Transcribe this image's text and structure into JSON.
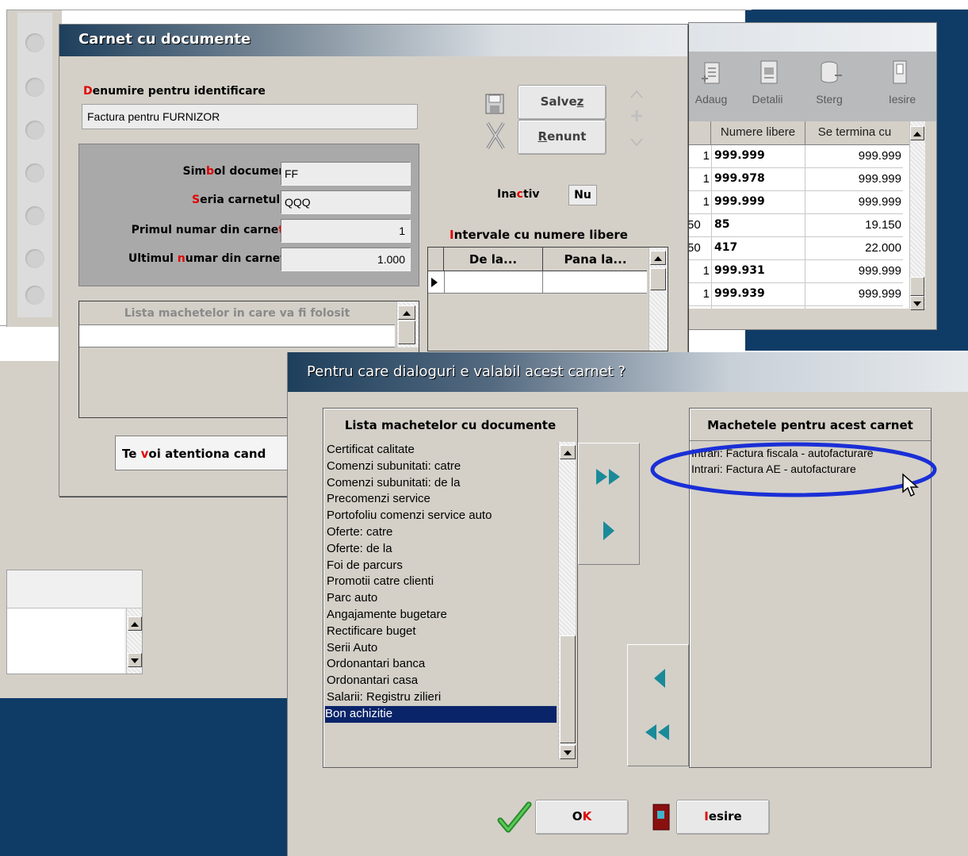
{
  "carnet_window": {
    "title": "Carnet cu documente",
    "denumire_label_first": "D",
    "denumire_label_rest": "enumire pentru identificare",
    "denumire_value": "Factura pentru FURNIZOR",
    "simbol_label_a": "Sim",
    "simbol_label_b": "b",
    "simbol_label_c": "ol document",
    "simbol_value": "FF",
    "seria_label_a": "S",
    "seria_label_b": "eria carnetului",
    "seria_value": "QQQ",
    "primul_label_a": "Primul numar din carne",
    "primul_label_b": "t",
    "primul_value": "1",
    "ultimul_label_a": "Ultimul ",
    "ultimul_label_b": "n",
    "ultimul_label_c": "umar din carnet",
    "ultimul_value": "1.000",
    "lista_machetelor_header": "Lista machetelor in care va fi folosit",
    "salvez_a": "Salve",
    "salvez_b": "z",
    "renunt_a": "R",
    "renunt_b": "enunt",
    "inactiv_a": "Ina",
    "inactiv_b": "c",
    "inactiv_c": "tiv",
    "inactiv_value": "Nu",
    "intervale_a": "I",
    "intervale_b": "ntervale cu numere libere",
    "intervale_columns": [
      "De la...",
      "Pana la..."
    ],
    "te_voi_a": "Te ",
    "te_voi_b": "v",
    "te_voi_c": "oi atentiona cand"
  },
  "back_window": {
    "toolbar": [
      "Adaug",
      "Detalii",
      "Sterg",
      "Iesire"
    ],
    "columns": [
      "Numere libere",
      "Se termina cu"
    ],
    "rows": [
      {
        "pre": "1",
        "libere": "999.999",
        "termina": "999.999"
      },
      {
        "pre": "1",
        "libere": "999.978",
        "termina": "999.999"
      },
      {
        "pre": "1",
        "libere": "999.999",
        "termina": "999.999"
      },
      {
        "pre": "50",
        "libere": "85",
        "termina": "19.150"
      },
      {
        "pre": "50",
        "libere": "417",
        "termina": "22.000"
      },
      {
        "pre": "1",
        "libere": "999.931",
        "termina": "999.999"
      },
      {
        "pre": "1",
        "libere": "999.939",
        "termina": "999.999"
      }
    ]
  },
  "dialog": {
    "title": "Pentru care dialoguri e valabil acest carnet ?",
    "left_header": "Lista machetelor cu documente",
    "right_header": "Machetele pentru acest carnet",
    "left_items": [
      "Certificat calitate",
      "Comenzi subunitati: catre",
      "Comenzi subunitati: de la",
      "Precomenzi service",
      "Portofoliu comenzi service auto",
      "Oferte: catre",
      "Oferte: de la",
      "Foi de parcurs",
      "Promotii catre clienti",
      "Parc auto",
      "Angajamente bugetare",
      "Rectificare buget",
      "Serii Auto",
      "Ordonantari banca",
      "Ordonantari casa",
      "Salarii: Registru zilieri",
      "Bon achizitie"
    ],
    "selected_index": 16,
    "right_items": [
      "Intrari: Factura fiscala - autofacturare",
      "Intrari: Factura AE - autofacturare"
    ],
    "ok_a": "O",
    "ok_b": "K",
    "iesire_a": "I",
    "iesire_b": "esire"
  },
  "colors": {
    "title_gradient_start": "#1e3f5c",
    "title_gradient_end": "#d8dde2",
    "dark_blue_bg": "#0f3c66",
    "teal_arrow": "#1a8a99",
    "selection": "#0a246a",
    "highlight_ellipse": "#1a2fd6",
    "accent_red": "#e00000"
  }
}
